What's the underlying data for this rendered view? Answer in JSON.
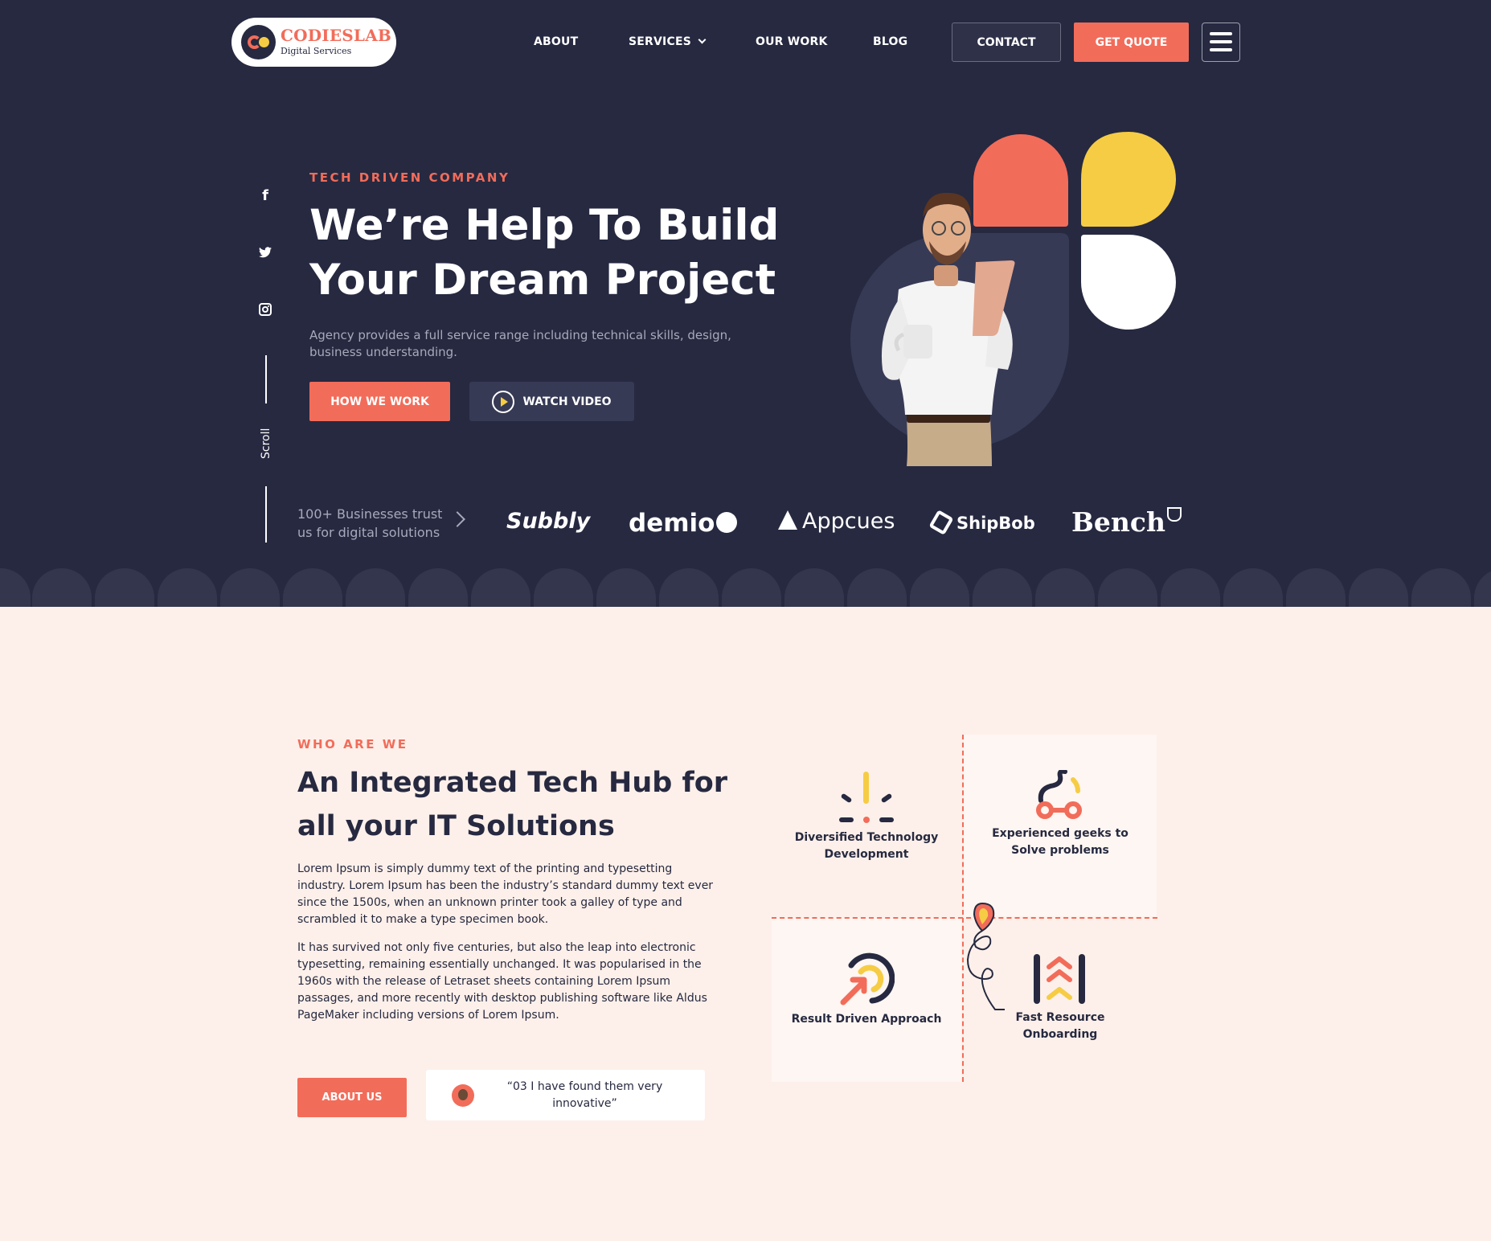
{
  "brand": {
    "name": "CODIESLAB",
    "tagline": "Digital Services"
  },
  "nav": {
    "about": "ABOUT",
    "services": "SERVICES",
    "our_work": "OUR WORK",
    "blog": "BLOG",
    "contact": "CONTACT",
    "get_quote": "GET QUOTE"
  },
  "hero": {
    "eyebrow": "TECH DRIVEN COMPANY",
    "title_line1": "We’re Help To Build",
    "title_line2": "Your Dream Project",
    "description": "Agency provides a full service range including technical skills, design, business understanding.",
    "how_we_work": "HOW WE WORK",
    "watch_video": "WATCH VIDEO",
    "scroll": "Scroll",
    "trust_text": "100+ Businesses trust us for digital solutions",
    "brands": [
      "Subbly",
      "demio",
      "Appcues",
      "ShipBob",
      "Bench"
    ]
  },
  "socials": [
    "facebook-icon",
    "twitter-icon",
    "instagram-icon"
  ],
  "about": {
    "eyebrow": "WHO ARE WE",
    "title": "An Integrated Tech Hub for all your IT Solutions",
    "paragraph1": "Lorem Ipsum is simply dummy text of the printing and typesetting industry. Lorem Ipsum has been the industry’s standard dummy text ever since the 1500s, when an unknown printer took a galley of type and scrambled it to make a type specimen book.",
    "paragraph2": "It has survived not only five centuries, but also the leap into electronic typesetting, remaining essentially unchanged. It was popularised in the 1960s with the release of Letraset sheets containing Lorem Ipsum passages, and more recently with desktop publishing software like Aldus PageMaker including versions of Lorem Ipsum.",
    "about_us": "ABOUT US",
    "quote": "“03 I have found them very innovative”"
  },
  "features": [
    {
      "label": "Diversified Technology Development",
      "icon": "spark-icon"
    },
    {
      "label": "Experienced geeks to Solve problems",
      "icon": "bike-icon"
    },
    {
      "label": "Result Driven Approach",
      "icon": "target-arrow-icon"
    },
    {
      "label": "Fast Resource Onboarding",
      "icon": "chevrons-up-icon"
    }
  ],
  "colors": {
    "navy": "#262940",
    "coral": "#f26c5a",
    "yellow": "#f6cc44",
    "cream": "#fdf0ea"
  }
}
